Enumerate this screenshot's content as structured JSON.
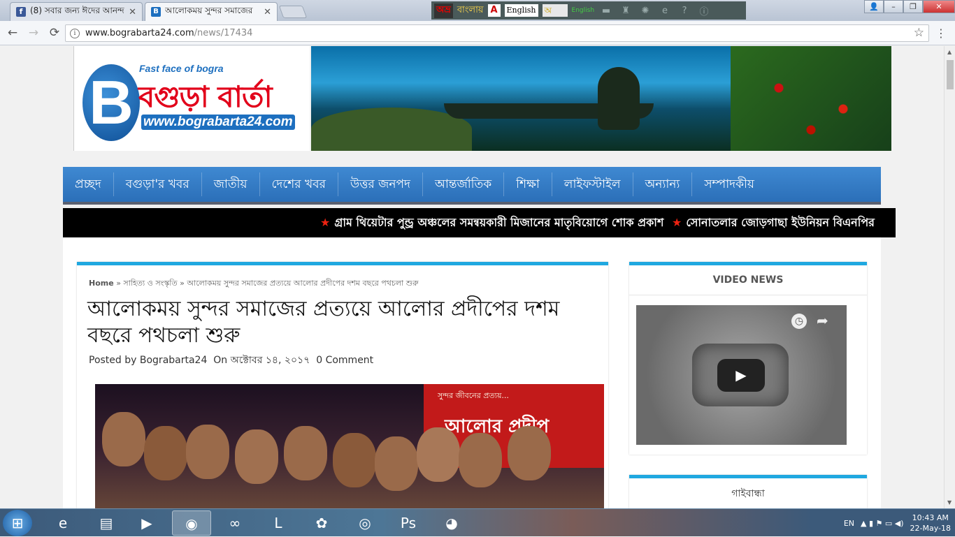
{
  "tabs": [
    {
      "title": "(8) সবার জন্য ঈদের আনন্দ",
      "favicon": "facebook-icon",
      "active": false
    },
    {
      "title": "আলোকময় সুন্দর সমাজের",
      "favicon": "bogra-barta-icon",
      "active": true
    }
  ],
  "avro": {
    "brand": "অভ্র",
    "name": "বাংলায়",
    "pdf": "A",
    "language": "English",
    "keyboard": "অ",
    "keyboard_mode": "English"
  },
  "window_controls": {
    "user": "👤",
    "minimize": "–",
    "maximize": "❐",
    "close": "✕"
  },
  "toolbar": {
    "back": "←",
    "forward": "→",
    "reload": "⟳",
    "url_host": "www.bograbarta24.com",
    "url_path": "/news/17434",
    "info": "i",
    "star": "☆",
    "menu": "⋮"
  },
  "logo": {
    "letter": "B",
    "tagline": "Fast face of bogra",
    "name": "বগুড়া বার্তা",
    "url": "www.bograbarta24.com"
  },
  "nav": [
    "প্রচ্ছদ",
    "বগুড়া'র খবর",
    "জাতীয়",
    "দেশের খবর",
    "উত্তর জনপদ",
    "আন্তর্জাতিক",
    "শিক্ষা",
    "লাইফস্টাইল",
    "অন্যান্য",
    "সম্পাদকীয়"
  ],
  "ticker": [
    "গ্রাম থিয়েটার পুন্ড্র অঞ্চলের সমন্বয়কারী মিজানের মাতৃবিয়োগে শোক প্রকাশ",
    "সোনাতলার জোড়গাছা ইউনিয়ন বিএনপির"
  ],
  "article": {
    "breadcrumb_home": "Home",
    "breadcrumb_sep": "»",
    "breadcrumb_category": "সাহিত্য ও সংস্কৃতি",
    "breadcrumb_current": "আলোকময় সুন্দর সমাজের প্রত্যয়ে আলোর প্রদীপের দশম বছরে পথচলা শুরু",
    "title": "আলোকময় সুন্দর সমাজের প্রত্যয়ে আলোর প্রদীপের দশম বছরে পথচলা শুরু",
    "posted_by_label": "Posted by",
    "author": "Bograbarta24",
    "on_label": "On",
    "date": "অক্টোবর ১৪, ২০১৭",
    "comments": "0 Comment",
    "photo_banner_tagline": "সুন্দর জীবনের প্রত্যয়...",
    "photo_banner_title": "আলোর প্রদীপ"
  },
  "sidebar": {
    "video_title": "VIDEO NEWS",
    "second_title": "গাইবান্ধা",
    "play": "▶",
    "clock": "◷",
    "share": "➦"
  },
  "taskbar": {
    "apps": [
      {
        "name": "internet-explorer",
        "glyph": "e"
      },
      {
        "name": "file-explorer",
        "glyph": "▤"
      },
      {
        "name": "media-player",
        "glyph": "▶"
      },
      {
        "name": "chrome",
        "glyph": "◉"
      },
      {
        "name": "visual-studio",
        "glyph": "∞"
      },
      {
        "name": "lync",
        "glyph": "L"
      },
      {
        "name": "flower-app",
        "glyph": "✿"
      },
      {
        "name": "disc-app",
        "glyph": "◎"
      },
      {
        "name": "photoshop",
        "glyph": "Ps"
      },
      {
        "name": "firefox",
        "glyph": "◕"
      }
    ],
    "language": "EN",
    "time": "10:43 AM",
    "date": "22-May-18",
    "start_glyph": "⊞",
    "tray_icons": "▲ ▮ ⚑ ▭ ◀)"
  },
  "scrollbar": {
    "up": "▲",
    "down": "▼"
  }
}
